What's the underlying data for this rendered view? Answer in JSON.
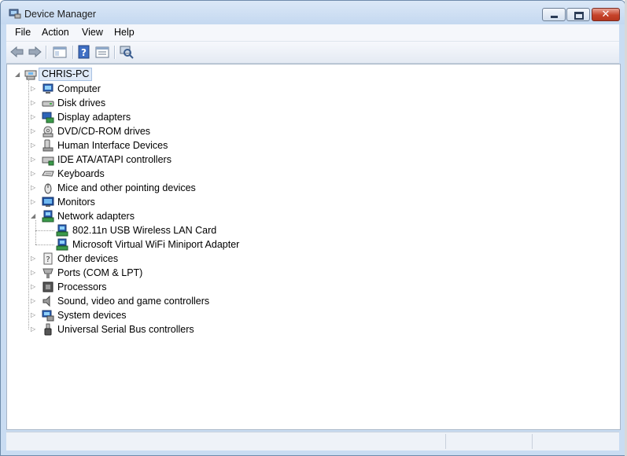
{
  "window": {
    "title": "Device Manager"
  },
  "caption_buttons": {
    "close_glyph": "✕"
  },
  "menu": [
    "File",
    "Action",
    "View",
    "Help"
  ],
  "toolbar": [
    "back-icon",
    "forward-icon",
    "show-hide-console-tree-icon",
    "help-icon",
    "properties-icon",
    "scan-hardware-icon"
  ],
  "tree": {
    "root": "CHRIS-PC",
    "categories": [
      {
        "label": "Computer",
        "icon": "computer-icon",
        "expanded": false
      },
      {
        "label": "Disk drives",
        "icon": "disk-drive-icon",
        "expanded": false
      },
      {
        "label": "Display adapters",
        "icon": "display-adapter-icon",
        "expanded": false
      },
      {
        "label": "DVD/CD-ROM drives",
        "icon": "dvd-drive-icon",
        "expanded": false
      },
      {
        "label": "Human Interface Devices",
        "icon": "hid-icon",
        "expanded": false
      },
      {
        "label": "IDE ATA/ATAPI controllers",
        "icon": "ide-controller-icon",
        "expanded": false
      },
      {
        "label": "Keyboards",
        "icon": "keyboard-icon",
        "expanded": false
      },
      {
        "label": "Mice and other pointing devices",
        "icon": "mouse-icon",
        "expanded": false
      },
      {
        "label": "Monitors",
        "icon": "monitor-icon",
        "expanded": false
      },
      {
        "label": "Network adapters",
        "icon": "network-adapter-icon",
        "expanded": true,
        "children": [
          "802.11n USB Wireless LAN Card",
          "Microsoft Virtual WiFi Miniport Adapter"
        ]
      },
      {
        "label": "Other devices",
        "icon": "other-devices-icon",
        "expanded": false
      },
      {
        "label": "Ports (COM & LPT)",
        "icon": "port-icon",
        "expanded": false
      },
      {
        "label": "Processors",
        "icon": "processor-icon",
        "expanded": false
      },
      {
        "label": "Sound, video and game controllers",
        "icon": "speaker-icon",
        "expanded": false
      },
      {
        "label": "System devices",
        "icon": "system-device-icon",
        "expanded": false
      },
      {
        "label": "Universal Serial Bus controllers",
        "icon": "usb-icon",
        "expanded": false
      }
    ]
  }
}
